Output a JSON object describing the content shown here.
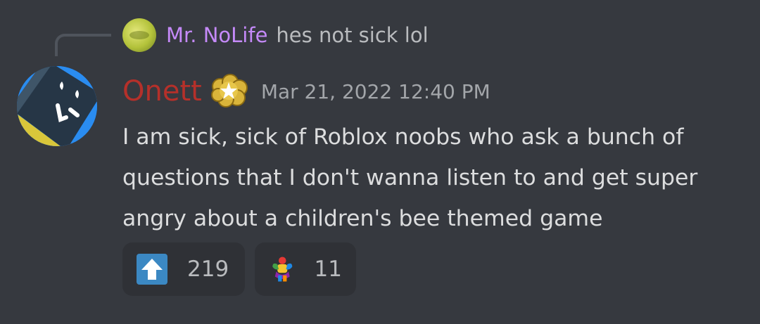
{
  "reply": {
    "author": "Mr. NoLife",
    "text": "hes not sick lol",
    "author_color": "#c58af9",
    "avatar_icon": "green-ball-avatar-icon"
  },
  "message": {
    "author": "Onett",
    "author_color": "#b5302a",
    "badge_icon": "gold-star-badge-icon",
    "timestamp": "Mar 21, 2022 12:40 PM",
    "content": "I am sick, sick of Roblox noobs who ask a bunch of\nquestions that I don't wanna listen to and get super\nangry about a children's bee themed game",
    "avatar_icon": "blue-cube-avatar-icon"
  },
  "reactions": [
    {
      "icon": "up-arrow-emoji-icon",
      "count": "219"
    },
    {
      "icon": "flexing-figure-emoji-icon",
      "count": "11"
    }
  ],
  "colors": {
    "background": "#36393f",
    "reaction_bg": "#2f3136",
    "text": "#dcddde",
    "muted": "#b9bbbe"
  }
}
